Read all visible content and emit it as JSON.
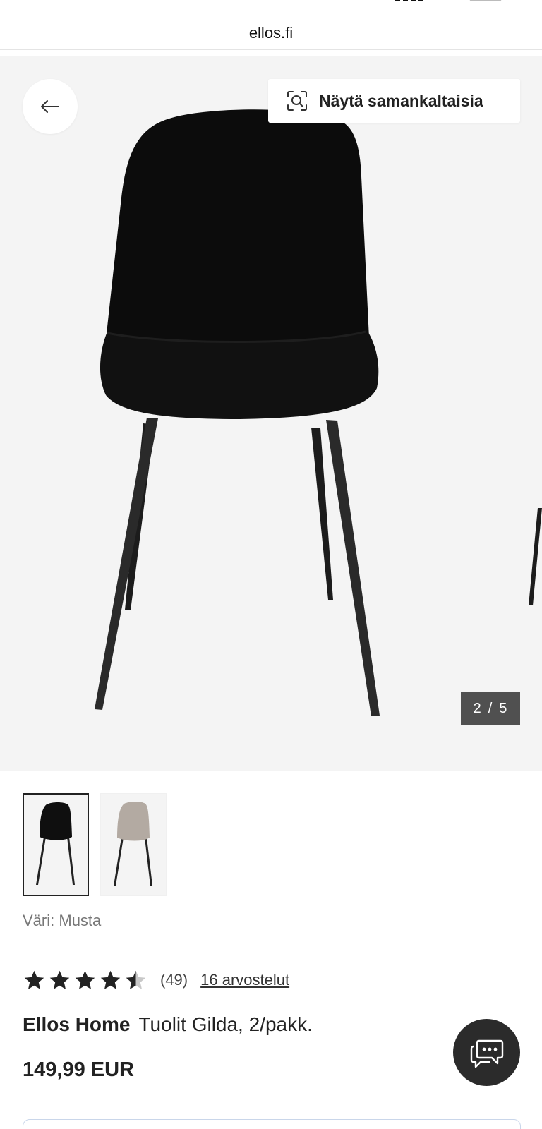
{
  "browser": {
    "url": "ellos.fi"
  },
  "gallery": {
    "similar_label": "Näytä samankaltaisia",
    "current_image": "2",
    "separator": "/",
    "total_images": "5"
  },
  "colors": {
    "label": "Väri:",
    "selected": "Musta",
    "options": [
      "Musta",
      "Beige"
    ]
  },
  "rating": {
    "stars": 4.5,
    "count_text": "(49)",
    "reviews_link": "16 arvostelut"
  },
  "product": {
    "brand": "Ellos Home",
    "name": "Tuolit Gilda, 2/pakk.",
    "price": "149,99 EUR"
  },
  "icons": {
    "back": "arrow-left-icon",
    "similar": "visual-search-icon",
    "chat": "chat-bubbles-icon",
    "star": "star-icon"
  },
  "theme": {
    "gallery_bg": "#f4f4f4",
    "counter_bg": "#505050",
    "chat_bg": "#2b2b2b",
    "text": "#222222"
  }
}
